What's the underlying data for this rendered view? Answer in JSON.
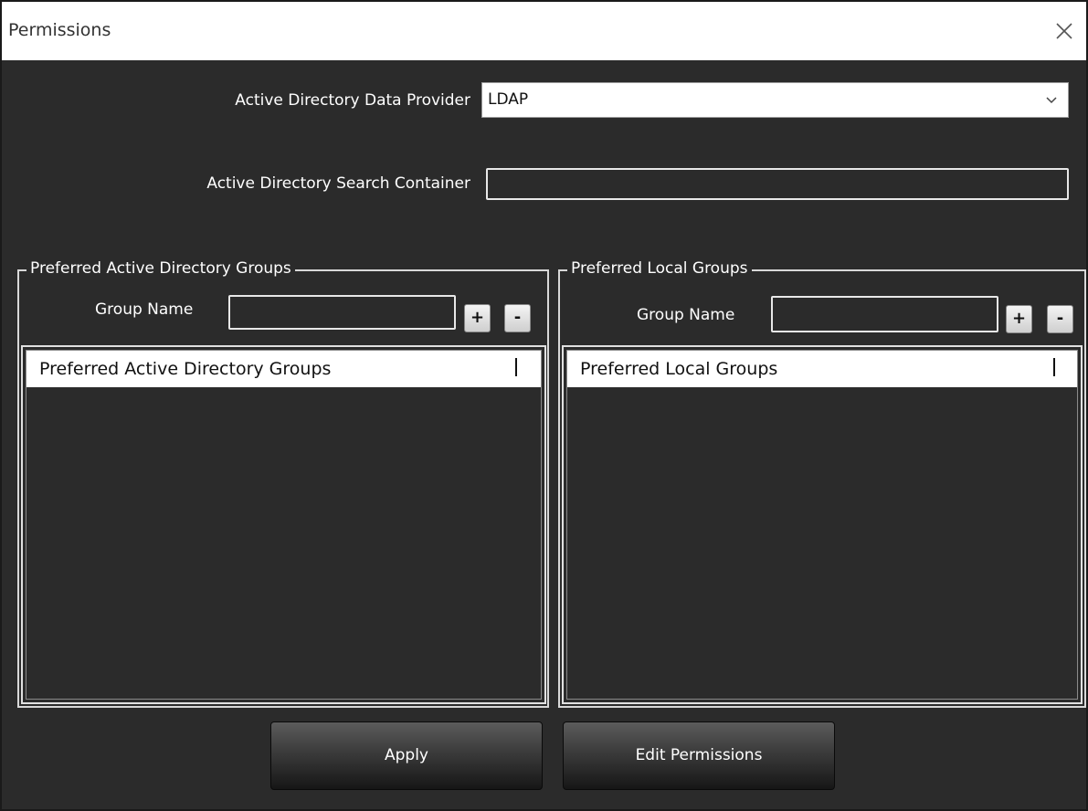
{
  "window": {
    "title": "Permissions",
    "close_icon": "close-icon"
  },
  "form": {
    "provider_label": "Active Directory Data Provider",
    "provider_value": "LDAP",
    "search_container_label": "Active Directory Search Container",
    "search_container_value": ""
  },
  "ad_groups": {
    "legend": "Preferred Active Directory Groups",
    "group_name_label": "Group Name",
    "group_name_value": "",
    "add_label": "+",
    "remove_label": "-",
    "list_header": "Preferred Active Directory Groups",
    "items": []
  },
  "local_groups": {
    "legend": "Preferred Local Groups",
    "group_name_label": "Group Name",
    "group_name_value": "",
    "add_label": "+",
    "remove_label": "-",
    "list_header": "Preferred Local Groups",
    "items": []
  },
  "buttons": {
    "apply": "Apply",
    "edit_permissions": "Edit Permissions"
  },
  "colors": {
    "background": "#2b2b2b",
    "titlebar": "#ffffff",
    "text": "#ffffff"
  }
}
